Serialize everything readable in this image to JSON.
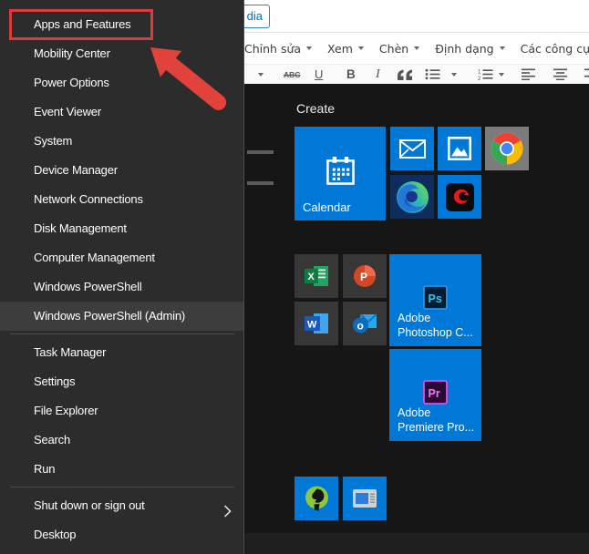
{
  "colors": {
    "accent_tile_blue": "#0078d7",
    "annotation_red": "#dc3b39",
    "menu_background": "#2c2c2c",
    "menu_highlight": "#3d3d3d"
  },
  "editor": {
    "media_button_label": "dia",
    "menu_items": [
      "Chỉnh sửa",
      "Xem",
      "Chèn",
      "Định dạng",
      "Các công cụ"
    ],
    "toolbar": {
      "strikethrough": "ABC",
      "underline": "U",
      "bold": "B",
      "italic": "I"
    }
  },
  "winx_menu": {
    "items": [
      "Apps and Features",
      "Mobility Center",
      "Power Options",
      "Event Viewer",
      "System",
      "Device Manager",
      "Network Connections",
      "Disk Management",
      "Computer Management",
      "Windows PowerShell",
      "Windows PowerShell (Admin)",
      "Task Manager",
      "Settings",
      "File Explorer",
      "Search",
      "Run",
      "Shut down or sign out",
      "Desktop"
    ],
    "highlighted_item": "Windows PowerShell (Admin)",
    "annotated_item": "Apps and Features"
  },
  "start_menu": {
    "group_label": "Create",
    "tiles": [
      {
        "name": "Calendar",
        "label": "Calendar"
      },
      {
        "name": "Mail"
      },
      {
        "name": "Photos"
      },
      {
        "name": "Google Chrome"
      },
      {
        "name": "Microsoft Edge"
      },
      {
        "name": "Garena"
      },
      {
        "name": "Excel"
      },
      {
        "name": "PowerPoint"
      },
      {
        "name": "Word"
      },
      {
        "name": "Outlook"
      },
      {
        "name": "Adobe Photoshop",
        "label_line1": "Adobe",
        "label_line2": "Photoshop C..."
      },
      {
        "name": "Adobe Premiere Pro",
        "label_line1": "Adobe",
        "label_line2": "Premiere Pro..."
      },
      {
        "name": "ORCA"
      },
      {
        "name": "Desktop app"
      }
    ]
  }
}
